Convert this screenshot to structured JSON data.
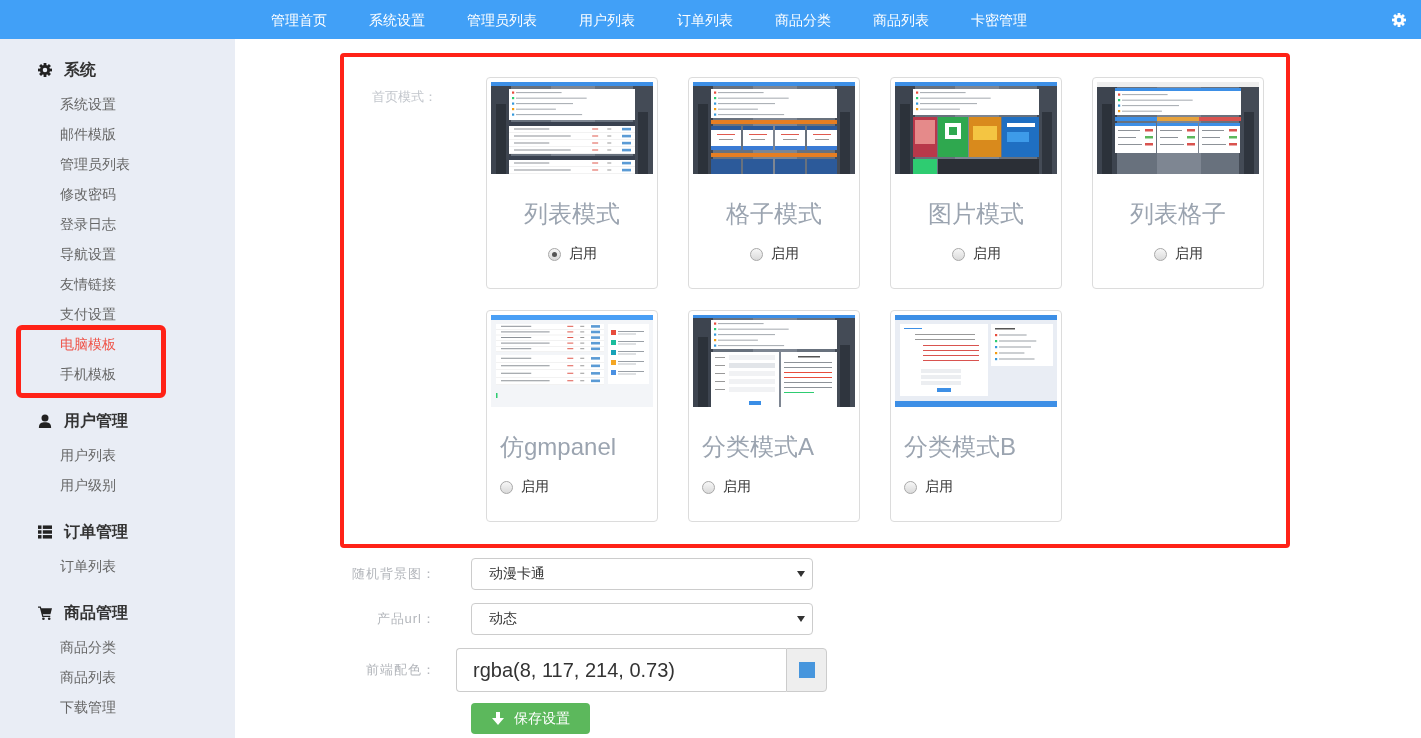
{
  "nav": {
    "items": [
      "管理首页",
      "系统设置",
      "管理员列表",
      "用户列表",
      "订单列表",
      "商品分类",
      "商品列表",
      "卡密管理"
    ]
  },
  "sidebar": {
    "groups": [
      {
        "title": "系统",
        "items": [
          {
            "label": "系统设置",
            "selected": false,
            "highlighted": false
          },
          {
            "label": "邮件模版",
            "selected": false,
            "highlighted": false
          },
          {
            "label": "管理员列表",
            "selected": false,
            "highlighted": false
          },
          {
            "label": "修改密码",
            "selected": false,
            "highlighted": false
          },
          {
            "label": "登录日志",
            "selected": false,
            "highlighted": false
          },
          {
            "label": "导航设置",
            "selected": false,
            "highlighted": false
          },
          {
            "label": "友情链接",
            "selected": false,
            "highlighted": false
          },
          {
            "label": "支付设置",
            "selected": false,
            "highlighted": false
          },
          {
            "label": "电脑模板",
            "selected": true,
            "highlighted": true
          },
          {
            "label": "手机模板",
            "selected": false,
            "highlighted": true
          }
        ]
      },
      {
        "title": "用户管理",
        "items": [
          {
            "label": "用户列表",
            "selected": false,
            "highlighted": false
          },
          {
            "label": "用户级别",
            "selected": false,
            "highlighted": false
          }
        ]
      },
      {
        "title": "订单管理",
        "items": [
          {
            "label": "订单列表",
            "selected": false,
            "highlighted": false
          }
        ]
      },
      {
        "title": "商品管理",
        "items": [
          {
            "label": "商品分类",
            "selected": false,
            "highlighted": false
          },
          {
            "label": "商品列表",
            "selected": false,
            "highlighted": false
          },
          {
            "label": "下载管理",
            "selected": false,
            "highlighted": false
          }
        ]
      }
    ]
  },
  "home_mode": {
    "label": "首页模式：",
    "highlighted": true,
    "cards": [
      {
        "title": "列表模式",
        "kind": "list",
        "centered": true,
        "radio_label": "启用",
        "selected": true
      },
      {
        "title": "格子模式",
        "kind": "grid",
        "centered": true,
        "radio_label": "启用",
        "selected": false
      },
      {
        "title": "图片模式",
        "kind": "images",
        "centered": true,
        "radio_label": "启用",
        "selected": false
      },
      {
        "title": "列表格子",
        "kind": "list-grid",
        "centered": true,
        "radio_label": "启用",
        "selected": false
      },
      {
        "title": "仿gmpanel",
        "kind": "gmpanel",
        "centered": false,
        "radio_label": "启用",
        "selected": false
      },
      {
        "title": "分类模式A",
        "kind": "category-a",
        "centered": false,
        "radio_label": "启用",
        "selected": false
      },
      {
        "title": "分类模式B",
        "kind": "category-b",
        "centered": false,
        "radio_label": "启用",
        "selected": false
      }
    ]
  },
  "fields": [
    {
      "label": "随机背景图：",
      "kind": "select",
      "value": "动漫卡通"
    },
    {
      "label": "产品url：",
      "kind": "select",
      "value": "动态"
    },
    {
      "label": "前端配色：",
      "kind": "color",
      "value": "rgba(8, 117, 214, 0.73)"
    }
  ],
  "save_button": {
    "label": "保存设置"
  }
}
